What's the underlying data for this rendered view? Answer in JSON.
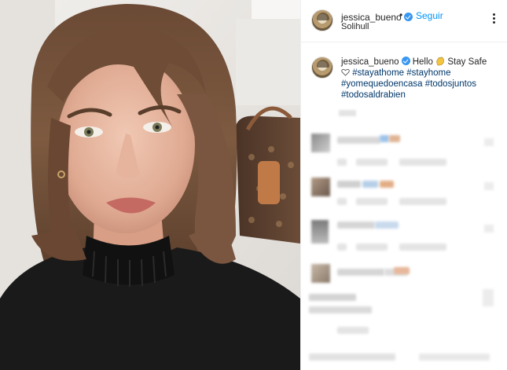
{
  "post": {
    "username": "jessica_bueno",
    "dot": "•",
    "follow_label": "Seguir",
    "location": "Solihull"
  },
  "caption": {
    "username": "jessica_bueno",
    "greeting": "Hello",
    "stay_safe": "Stay Safe",
    "hashtags_line1": [
      "#stayathome",
      "#stayhome"
    ],
    "hashtags_line2": [
      "#yomequedoencasa",
      "#todosjuntos"
    ],
    "hashtags_line3": [
      "#todosaldrabien"
    ]
  },
  "icons": {
    "verified": "verified-badge-icon",
    "more": "more-options-icon",
    "heart": "heart-icon",
    "wave": "waving-hand-icon"
  },
  "colors": {
    "follow": "#0095f6",
    "hashtag": "#00376b",
    "verified": "#3897f0",
    "text": "#262626"
  }
}
